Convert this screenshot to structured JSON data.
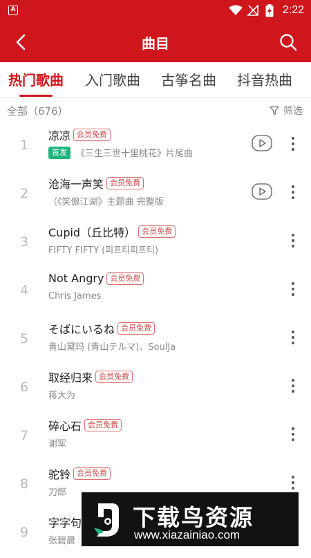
{
  "status_bar": {
    "app_icon_label": "A",
    "time": "2:22",
    "icons": [
      "app-notification-icon",
      "wifi-icon",
      "no-signal-icon",
      "battery-charging-icon"
    ]
  },
  "app_bar": {
    "title": "曲目",
    "back_icon": "back-arrow-icon",
    "search_icon": "search-icon",
    "color": "#d0161d"
  },
  "tabs": [
    {
      "label": "热门歌曲",
      "active": true
    },
    {
      "label": "入门歌曲",
      "active": false
    },
    {
      "label": "古筝名曲",
      "active": false
    },
    {
      "label": "抖音热曲",
      "active": false
    }
  ],
  "summary": {
    "count_text": "全部（676）",
    "filter_label": "筛选",
    "filter_icon": "filter-icon"
  },
  "songs": [
    {
      "num": "1",
      "title": "凉凉",
      "badge": "会员免费",
      "tag": "首发",
      "artist": "《三生三世十里桃花》片尾曲",
      "has_play": true
    },
    {
      "num": "2",
      "title": "沧海一声笑",
      "badge": "会员免费",
      "tag": "",
      "artist": "（《笑傲江湖》主题曲 完整版",
      "has_play": true
    },
    {
      "num": "3",
      "title": "Cupid（丘比特）",
      "badge": "会员免费",
      "tag": "",
      "artist": "FIFTY FIFTY (피프티피프티)",
      "has_play": false
    },
    {
      "num": "4",
      "title": "Not Angry",
      "badge": "会员免费",
      "tag": "",
      "artist": "Chris James",
      "has_play": false
    },
    {
      "num": "5",
      "title": "そばにいるね",
      "badge": "会员免费",
      "tag": "",
      "artist": "青山黛玛 (青山テルマ)、SoulJa",
      "has_play": false
    },
    {
      "num": "6",
      "title": "取经归来",
      "badge": "会员免费",
      "tag": "",
      "artist": "蒋大为",
      "has_play": false
    },
    {
      "num": "7",
      "title": "碎心石",
      "badge": "会员免费",
      "tag": "",
      "artist": "谢军",
      "has_play": false
    },
    {
      "num": "8",
      "title": "驼铃",
      "badge": "会员免费",
      "tag": "",
      "artist": "刀郎",
      "has_play": false
    },
    {
      "num": "9",
      "title": "字字句",
      "badge": "",
      "tag": "",
      "artist": "张碧晨",
      "has_play": false
    }
  ],
  "watermark": {
    "name": "下载鸟资源",
    "url": "www.xiazainiao.com"
  }
}
